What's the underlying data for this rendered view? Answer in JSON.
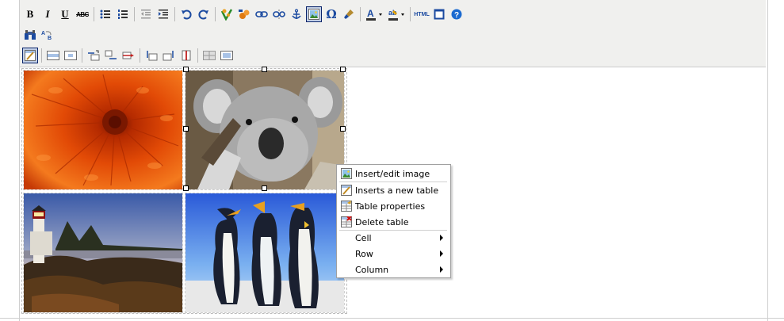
{
  "toolbar": {
    "row1": {
      "bold": "B",
      "italic": "I",
      "underline": "U",
      "strikethrough": "ABC",
      "html_source": "HTML",
      "special_char": "Ω"
    }
  },
  "context_menu": {
    "items": [
      {
        "label": "Insert/edit image",
        "icon": "image-icon"
      },
      {
        "label": "Inserts a new table",
        "icon": "table-insert-icon"
      },
      {
        "label": "Table properties",
        "icon": "table-properties-icon"
      },
      {
        "label": "Delete table",
        "icon": "table-delete-icon"
      },
      {
        "label": "Cell",
        "icon": "none",
        "submenu": true
      },
      {
        "label": "Row",
        "icon": "none",
        "submenu": true
      },
      {
        "label": "Column",
        "icon": "none",
        "submenu": true
      }
    ]
  },
  "table": {
    "images": [
      "chrysanthemum-image",
      "koala-image",
      "lighthouse-image",
      "penguins-image"
    ]
  },
  "colors": {
    "toolbar_bg": "#f0f0ee",
    "active_button_border": "#0a246a",
    "active_button_bg": "#c2cfe5",
    "menu_border": "#a0a0a0"
  }
}
